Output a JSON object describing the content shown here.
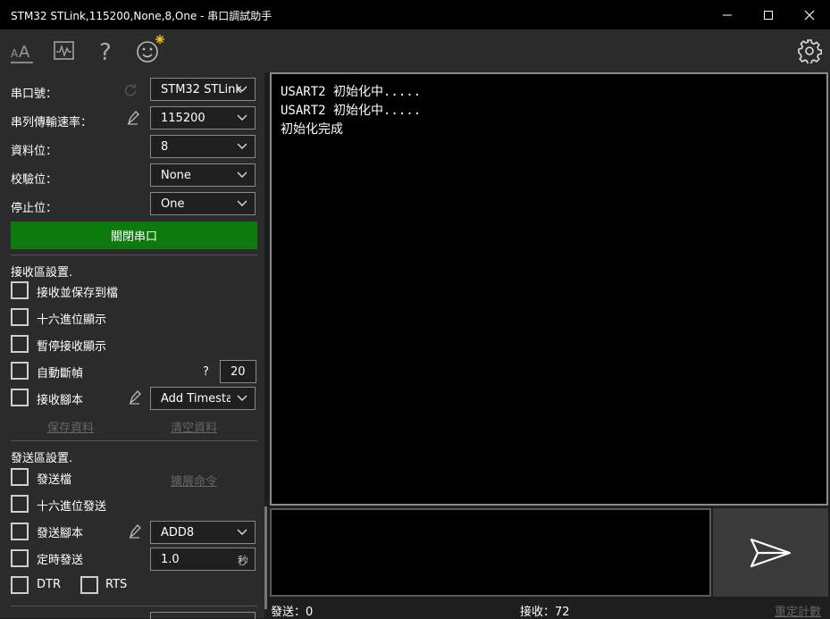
{
  "window": {
    "title": "STM32 STLink,115200,None,8,One - 串口調試助手"
  },
  "left": {
    "port_label": "串口號：",
    "port_value": "STM32 STLink",
    "baud_label": "串列傳輸速率：",
    "baud_value": "115200",
    "databits_label": "資料位：",
    "databits_value": "8",
    "parity_label": "校驗位：",
    "parity_value": "None",
    "stopbits_label": "停止位：",
    "stopbits_value": "One",
    "close_port_label": "關閉串口",
    "recv_section": "接收區設置.",
    "recv_save_file": "接收並保存到檔",
    "recv_hex_display": "十六進位顯示",
    "recv_pause_display": "暫停接收顯示",
    "recv_auto_frame": "自動斷幀",
    "recv_help": "?",
    "recv_frame_value": "20",
    "recv_script": "接收腳本",
    "recv_script_value": "Add Timesta",
    "save_data": "保存資料",
    "clear_data": "清空資料",
    "send_section": "發送區設置.",
    "send_file": "發送檔",
    "expand_cmd": "擴展命令",
    "send_hex": "十六進位發送",
    "send_script": "發送腳本",
    "send_script_value": "ADD8",
    "send_timer": "定時發送",
    "send_timer_value": "1.0",
    "send_timer_unit": "秒",
    "dtr": "DTR",
    "rts": "RTS"
  },
  "recv": {
    "lines": [
      "USART2 初始化中.....",
      "USART2 初始化中.....",
      "初始化完成"
    ]
  },
  "status": {
    "sent": "發送：0",
    "received": "接收：72",
    "reset_count": "重定計數"
  }
}
